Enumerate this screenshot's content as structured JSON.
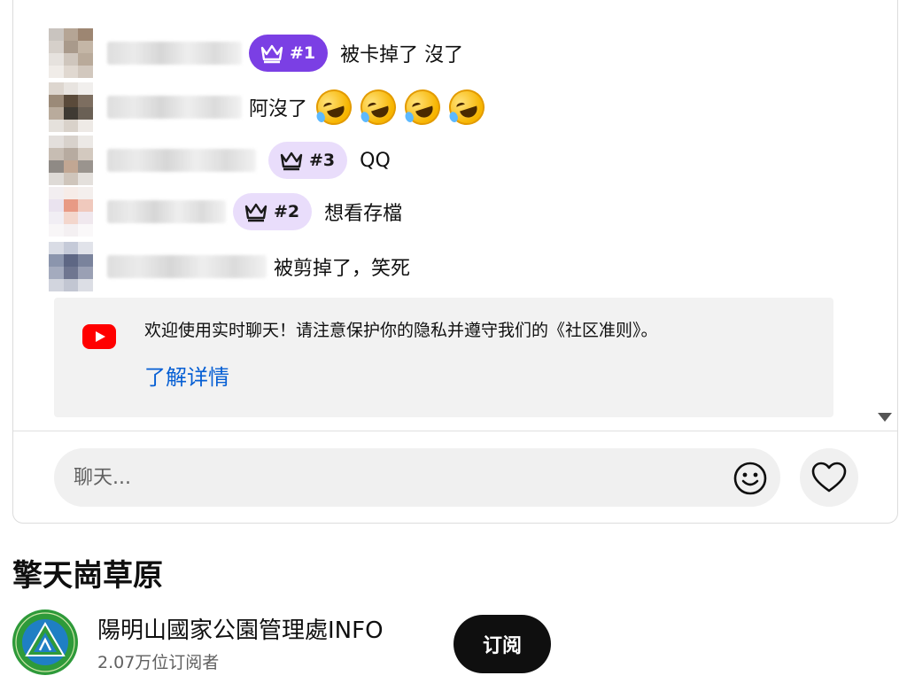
{
  "chat": {
    "messages": [
      {
        "badge": "#1",
        "badge_style": "purple",
        "text": "被卡掉了 沒了",
        "emoji_count": 0
      },
      {
        "badge": "",
        "badge_style": "none",
        "text": "阿沒了",
        "emoji": "rolling-on-floor-laughing",
        "emoji_count": 4
      },
      {
        "badge": "#3",
        "badge_style": "light",
        "text": "QQ",
        "emoji_count": 0
      },
      {
        "badge": "#2",
        "badge_style": "light",
        "text": "想看存檔",
        "emoji_count": 0
      },
      {
        "badge": "",
        "badge_style": "none",
        "text": "被剪掉了，笑死",
        "emoji_count": 0
      }
    ],
    "notice": {
      "text": "欢迎使用实时聊天！请注意保护你的隐私并遵守我们的《社区准则》。",
      "link": "了解详情"
    },
    "input_placeholder": "聊天..."
  },
  "video": {
    "title": "擎天崗草原"
  },
  "channel": {
    "name": "陽明山國家公園管理處INFO",
    "subscribers": "2.07万位订阅者",
    "subscribe_label": "订阅"
  },
  "colors": {
    "badge_purple": "#7b3fe4",
    "badge_light": "#e9ddfb",
    "link_blue": "#065fd4",
    "youtube_red": "#ff0000"
  }
}
